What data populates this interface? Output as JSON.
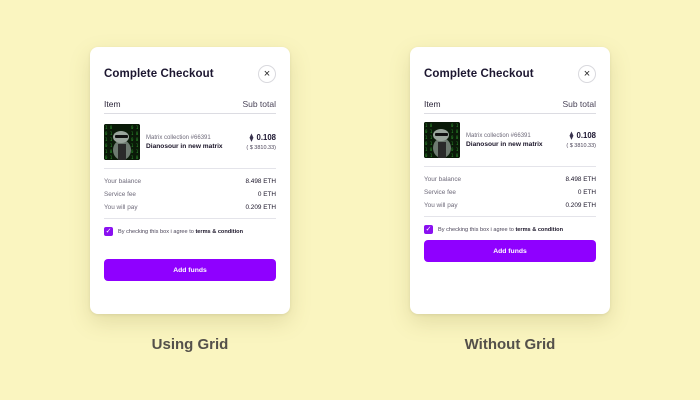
{
  "cards": [
    {
      "title": "Complete Checkout",
      "close_glyph": "×",
      "item_header": "Item",
      "subtotal_header": "Sub total",
      "collection": "Matrix collection #66391",
      "item_name": "Dianosour in new matrix",
      "eth_glyph": "⧫",
      "eth_amount": "0.108",
      "usd_amount": "( $ 3810.33)",
      "summary": [
        {
          "label": "Your balance",
          "value": "8.498 ETH"
        },
        {
          "label": "Service fee",
          "value": "0 ETH"
        },
        {
          "label": "You will pay",
          "value": "0.209 ETH"
        }
      ],
      "terms_prefix": "By checking this box i agree to",
      "terms_link": "terms & condition",
      "button_label": "Add funds"
    },
    {
      "title": "Complete Checkout",
      "close_glyph": "×",
      "item_header": "Item",
      "subtotal_header": "Sub total",
      "collection": "Matrix collection #66391",
      "item_name": "Dianosour in new matrix",
      "eth_glyph": "⧫",
      "eth_amount": "0.108",
      "usd_amount": "( $ 3810.33)",
      "summary": [
        {
          "label": "Your balance",
          "value": "8.498 ETH"
        },
        {
          "label": "Service fee",
          "value": "0 ETH"
        },
        {
          "label": "You will pay",
          "value": "0.209 ETH"
        }
      ],
      "terms_prefix": "By checking this box i agree to",
      "terms_link": "terms & condition",
      "button_label": "Add funds"
    }
  ],
  "captions": [
    "Using Grid",
    "Without Grid"
  ],
  "colors": {
    "background": "#faf5c0",
    "accent": "#8f00ff",
    "caption": "#54504a"
  },
  "icons": {
    "close": "close-icon",
    "eth": "ethereum-icon",
    "check": "checkmark-icon"
  }
}
